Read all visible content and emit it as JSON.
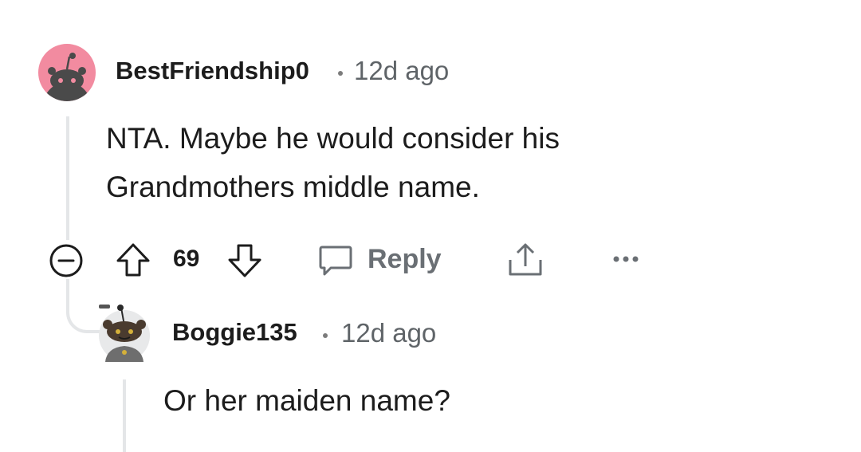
{
  "comment": {
    "username": "BestFriendship0",
    "separator": "•",
    "time": "12d ago",
    "body_lines": [
      "NTA. Maybe he would consider his",
      "Grandmothers middle name."
    ],
    "score": "69",
    "reply_label": "Reply",
    "avatar_color": "#f28ba0"
  },
  "reply": {
    "username": "Boggie135",
    "separator": "•",
    "time": "12d ago",
    "body": "Or her maiden name?"
  },
  "icons": {
    "collapse": "collapse-minus-icon",
    "upvote": "upvote-arrow-icon",
    "downvote": "downvote-arrow-icon",
    "reply": "speech-bubble-icon",
    "share": "share-icon",
    "more": "more-options-icon"
  }
}
